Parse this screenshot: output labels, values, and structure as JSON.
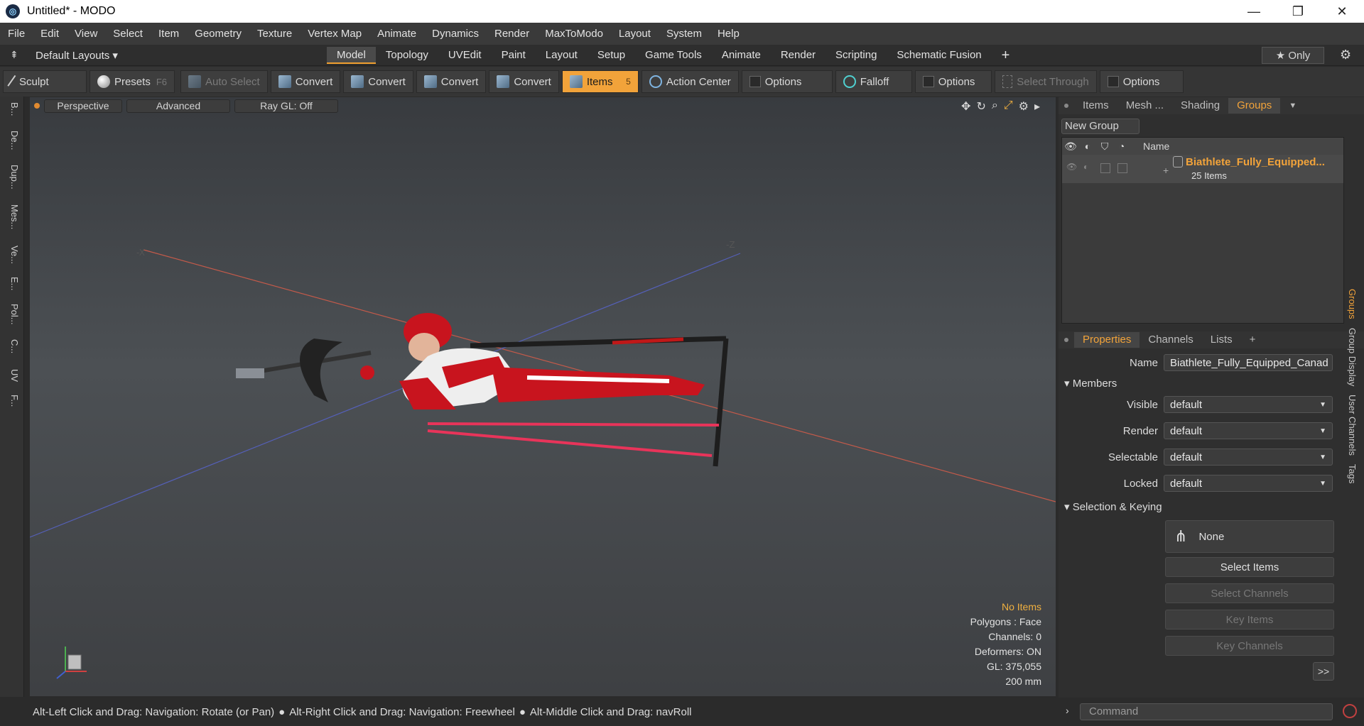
{
  "window": {
    "title": "Untitled* - MODO"
  },
  "menu": [
    "File",
    "Edit",
    "View",
    "Select",
    "Item",
    "Geometry",
    "Texture",
    "Vertex Map",
    "Animate",
    "Dynamics",
    "Render",
    "MaxToModo",
    "Layout",
    "System",
    "Help"
  ],
  "layout_bar": {
    "layout_select": "Default Layouts ▾",
    "tabs": [
      "Model",
      "Topology",
      "UVEdit",
      "Paint",
      "Layout",
      "Setup",
      "Game Tools",
      "Animate",
      "Render",
      "Scripting",
      "Schematic Fusion"
    ],
    "active_tab": "Model",
    "add": "+",
    "only": "★  Only"
  },
  "toolbar": {
    "sculpt": "Sculpt",
    "presets": "Presets",
    "presets_key": "F6",
    "auto_select": "Auto Select",
    "convert1": "Convert",
    "convert2": "Convert",
    "convert3": "Convert",
    "convert4": "Convert",
    "items": "Items",
    "items_key": "5",
    "action_center": "Action Center",
    "options1": "Options",
    "falloff": "Falloff",
    "options2": "Options",
    "select_through": "Select Through",
    "options3": "Options"
  },
  "left_tabs": [
    "B...",
    "De...",
    "Dup...",
    "Mes...",
    "Ve...",
    "E...",
    "Pol...",
    "C...",
    "UV",
    "F..."
  ],
  "viewport": {
    "perspective": "Perspective",
    "advanced": "Advanced",
    "raygl": "Ray GL: Off",
    "info": {
      "no_items": "No Items",
      "polygons": "Polygons : Face",
      "channels": "Channels: 0",
      "deformers": "Deformers: ON",
      "gl": "GL: 375,055",
      "scale": "200 mm"
    }
  },
  "groups_panel": {
    "tabs": [
      "Items",
      "Mesh ...",
      "Shading",
      "Groups"
    ],
    "active_tab": "Groups",
    "new_group": "New Group",
    "col_name": "Name",
    "group_name": "Biathlete_Fully_Equipped...",
    "group_count": "25 Items"
  },
  "properties_panel": {
    "tabs": [
      "Properties",
      "Channels",
      "Lists"
    ],
    "active_tab": "Properties",
    "add": "+",
    "name_label": "Name",
    "name_value": "Biathlete_Fully_Equipped_Canad",
    "members": "Members",
    "visible_label": "Visible",
    "visible_value": "default",
    "render_label": "Render",
    "render_value": "default",
    "selectable_label": "Selectable",
    "selectable_value": "default",
    "locked_label": "Locked",
    "locked_value": "default",
    "selection_keying": "Selection & Keying",
    "none": "None",
    "select_items": "Select Items",
    "select_channels": "Select Channels",
    "key_items": "Key Items",
    "key_channels": "Key Channels",
    "more": ">>",
    "side_tabs": [
      "Groups",
      "Group Display",
      "User Channels",
      "Tags"
    ]
  },
  "status": {
    "hint1": "Alt-Left Click and Drag: Navigation: Rotate (or Pan)",
    "hint2": "Alt-Right Click and Drag: Navigation: Freewheel",
    "hint3": "Alt-Middle Click and Drag: navRoll",
    "command": "Command"
  }
}
